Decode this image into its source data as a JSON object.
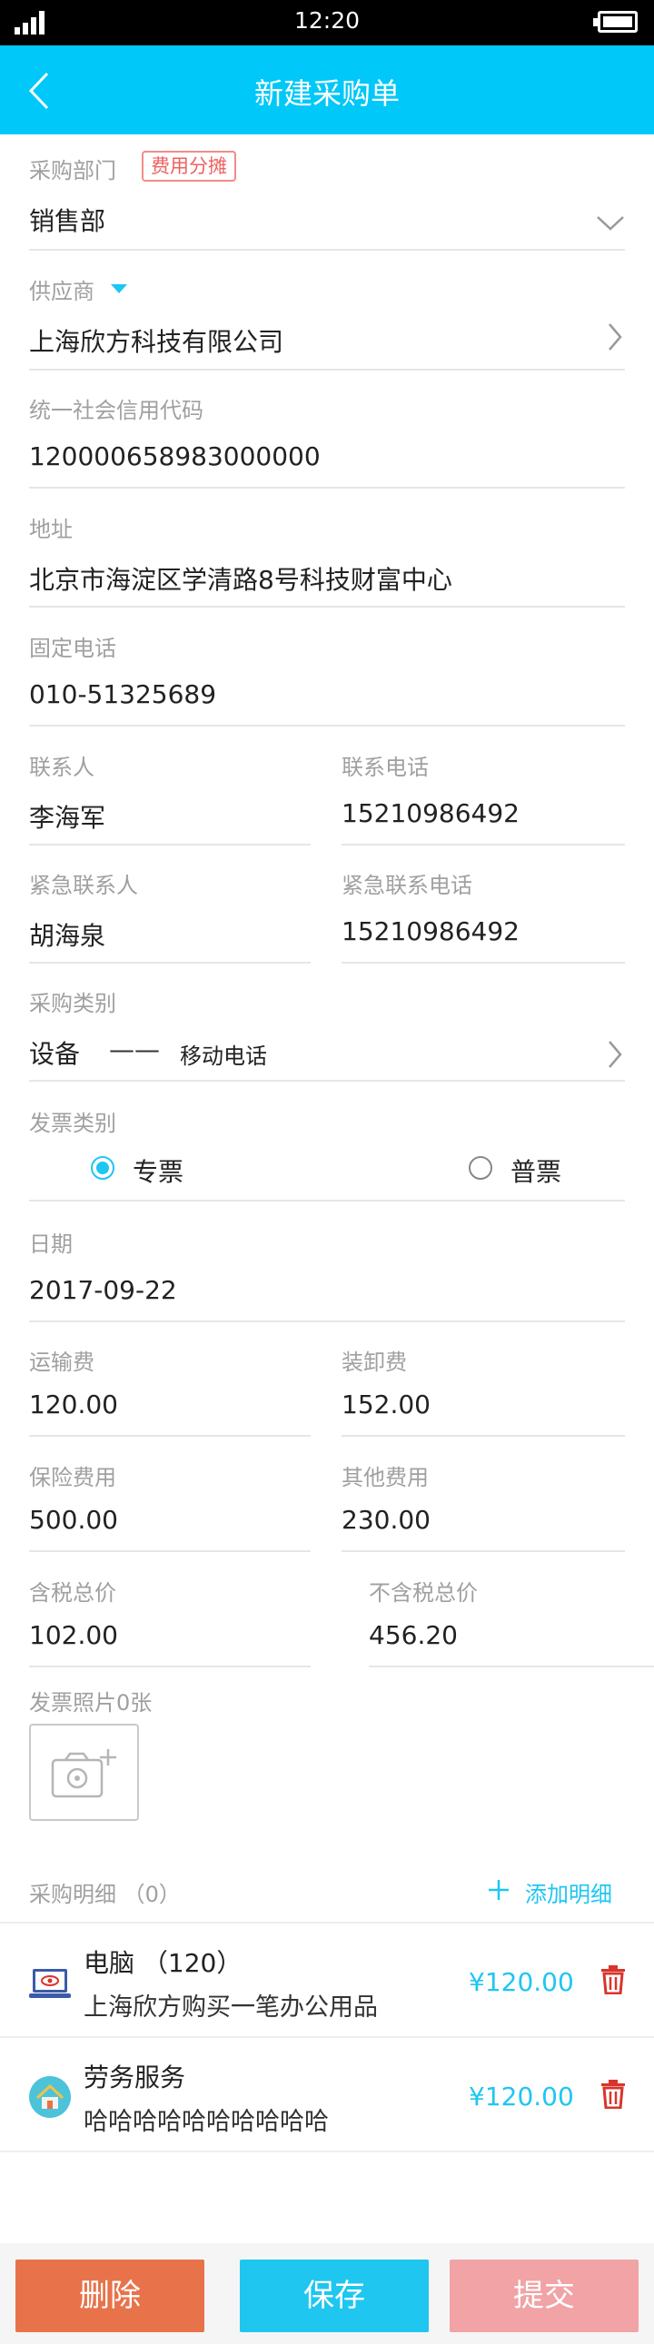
{
  "status": {
    "time": "12:20"
  },
  "nav": {
    "title": "新建采购单"
  },
  "form": {
    "department": {
      "label": "采购部门",
      "tag": "费用分摊",
      "value": "销售部"
    },
    "supplier": {
      "label": "供应商",
      "value": "上海欣方科技有限公司"
    },
    "credit_code": {
      "label": "统一社会信用代码",
      "value": "120000658983000000"
    },
    "address": {
      "label": "地址",
      "value": "北京市海淀区学清路8号科技财富中心"
    },
    "phone": {
      "label": "固定电话",
      "value": "010-51325689"
    },
    "contact": {
      "label": "联系人",
      "value": "李海军"
    },
    "contact_phone": {
      "label": "联系电话",
      "value": "15210986492"
    },
    "emergency_contact": {
      "label": "紧急联系人",
      "value": "胡海泉"
    },
    "emergency_phone": {
      "label": "紧急联系电话",
      "value": "15210986492"
    },
    "purchase_type": {
      "label": "采购类别",
      "main": "设备",
      "dash": "——",
      "sub": "移动电话"
    },
    "invoice_type": {
      "label": "发票类别",
      "option1": "专票",
      "option2": "普票",
      "selected": "专票"
    },
    "date": {
      "label": "日期",
      "value": "2017-09-22"
    },
    "freight": {
      "label": "运输费",
      "value": "120.00"
    },
    "handling": {
      "label": "装卸费",
      "value": "152.00"
    },
    "insurance": {
      "label": "保险费用",
      "value": "500.00"
    },
    "other": {
      "label": "其他费用",
      "value": "230.00"
    },
    "tax_total": {
      "label": "含税总价",
      "value": "102.00"
    },
    "pretax_total": {
      "label": "不含税总价",
      "value": "456.20"
    },
    "invoice_photos": {
      "label": "发票照片0张"
    }
  },
  "details": {
    "header": "采购明细 （0）",
    "add_label": "添加明细",
    "items": [
      {
        "title": "电脑 （120）",
        "desc": "上海欣方购买一笔办公用品",
        "price": "¥120.00",
        "icon": "laptop-icon"
      },
      {
        "title": "劳务服务",
        "desc": "哈哈哈哈哈哈哈哈哈哈",
        "price": "¥120.00",
        "icon": "house-icon"
      }
    ]
  },
  "actions": {
    "delete": "删除",
    "save": "保存",
    "submit": "提交"
  },
  "colors": {
    "accent": "#00c8f8",
    "delete": "#e8734a",
    "save": "#1fc6f0",
    "submit": "#f1a3a5",
    "trash": "#d9342b"
  }
}
